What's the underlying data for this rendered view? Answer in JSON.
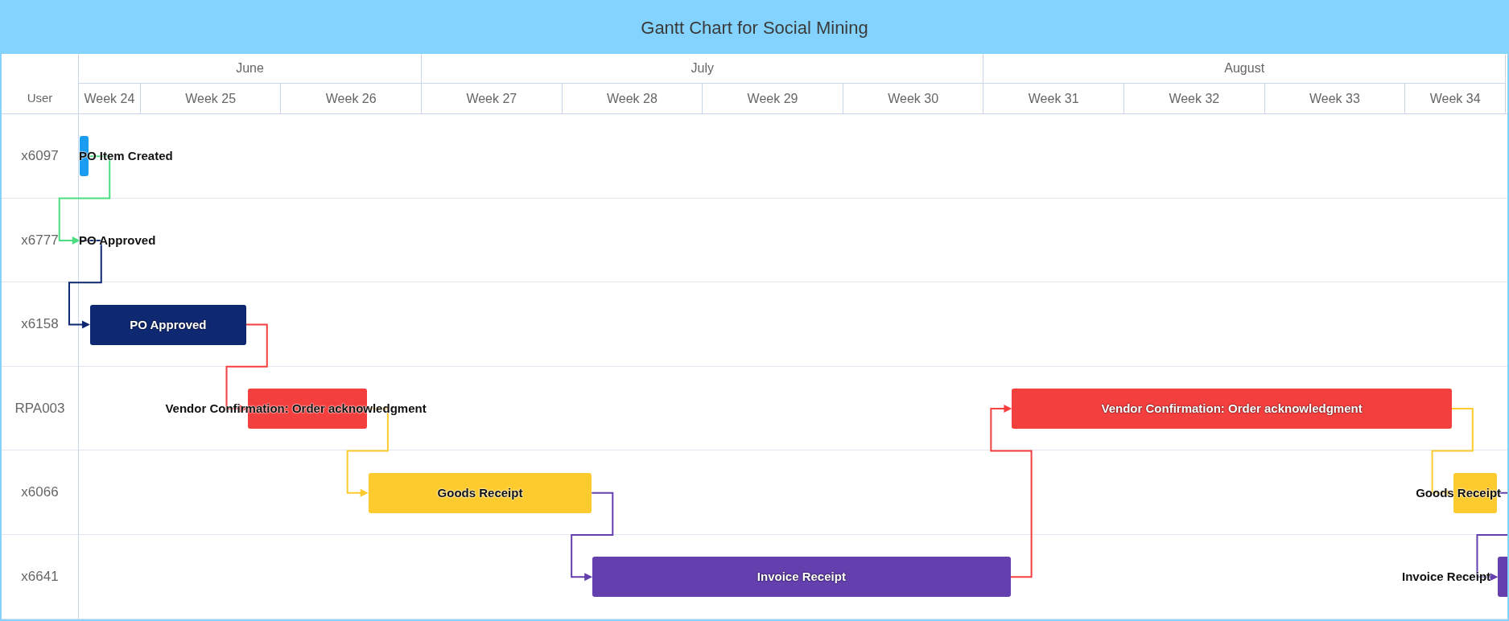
{
  "title": "Gantt Chart for Social Mining",
  "header": {
    "user_column": "User",
    "months": [
      {
        "label": "June",
        "weeks": [
          {
            "label": "Week 24"
          },
          {
            "label": "Week 25"
          },
          {
            "label": "Week 26"
          }
        ]
      },
      {
        "label": "July",
        "weeks": [
          {
            "label": "Week 27"
          },
          {
            "label": "Week 28"
          },
          {
            "label": "Week 29"
          },
          {
            "label": "Week 30"
          }
        ]
      },
      {
        "label": "August",
        "weeks": [
          {
            "label": "Week 31"
          },
          {
            "label": "Week 32"
          },
          {
            "label": "Week 33"
          },
          {
            "label": "Week 34"
          }
        ]
      }
    ]
  },
  "rows": [
    {
      "user": "x6097",
      "tasks": [
        {
          "label": "PO Item Created",
          "color": "#1a9cf0",
          "linked": false
        }
      ]
    },
    {
      "user": "x6777",
      "tasks": [
        {
          "label": "PO Approved",
          "color": "#4ade80",
          "linked": true
        }
      ]
    },
    {
      "user": "x6158",
      "tasks": [
        {
          "label": "PO Approved",
          "color": "#0f2872",
          "linked": true
        }
      ]
    },
    {
      "user": "RPA003",
      "tasks": [
        {
          "label": "Vendor Confirmation: Order acknowledgment",
          "color": "#f43f3f",
          "linked": true
        },
        {
          "label": "Vendor Confirmation: Order acknowledgment",
          "color": "#f43f3f",
          "linked": true
        }
      ]
    },
    {
      "user": "x6066",
      "tasks": [
        {
          "label": "Goods Receipt",
          "color": "#fecb2e",
          "linked": true
        },
        {
          "label": "Goods Receipt",
          "color": "#fecb2e",
          "linked": true
        }
      ]
    },
    {
      "user": "x6641",
      "tasks": [
        {
          "label": "Invoice Receipt",
          "color": "#643fae",
          "linked": true
        },
        {
          "label": "Invoice Receipt",
          "color": "#643fae",
          "linked": true
        }
      ]
    }
  ]
}
